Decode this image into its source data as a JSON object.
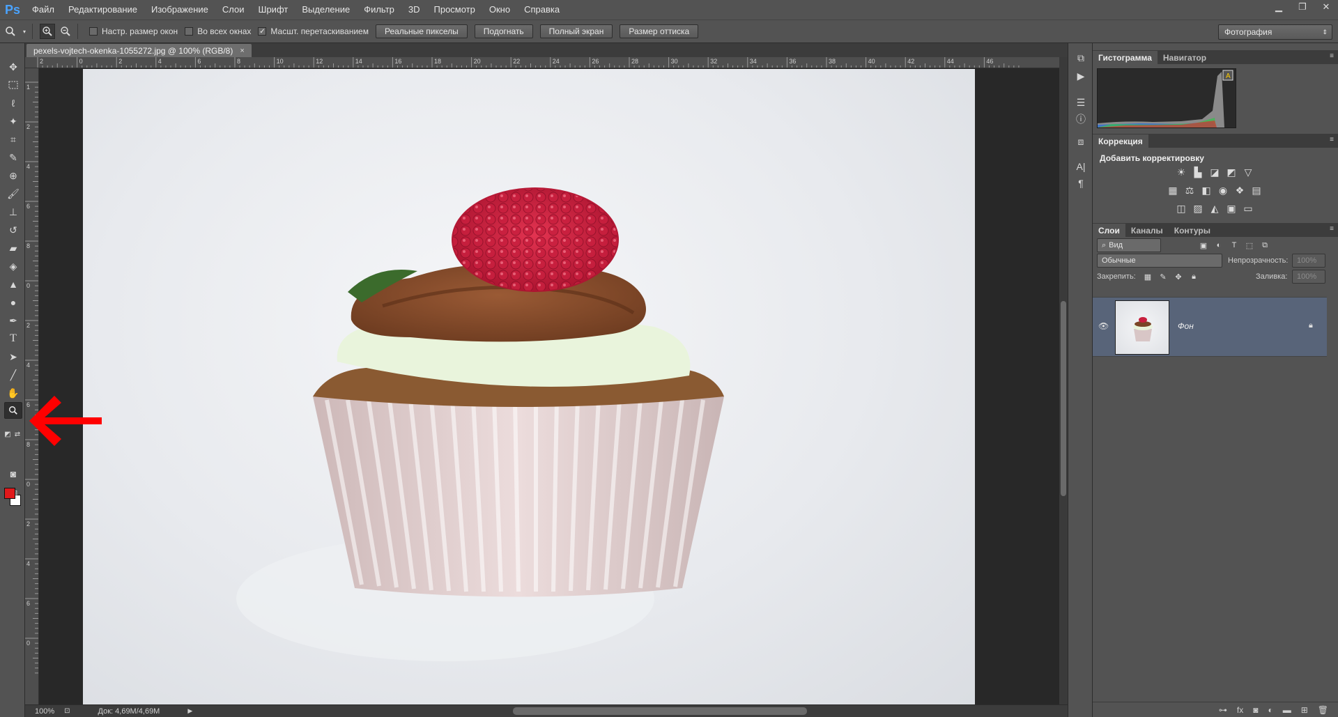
{
  "app": {
    "logo": "Ps"
  },
  "menu": [
    "Файл",
    "Редактирование",
    "Изображение",
    "Слои",
    "Шрифт",
    "Выделение",
    "Фильтр",
    "3D",
    "Просмотр",
    "Окно",
    "Справка"
  ],
  "window_controls": {
    "minimize": "▁",
    "restore": "❐",
    "close": "✕"
  },
  "options": {
    "resize_windows": "Настр. размер окон",
    "all_windows": "Во всех окнах",
    "scrubby_zoom": "Масшт. перетаскиванием",
    "actual_pixels": "Реальные пикселы",
    "fit_screen": "Подогнать",
    "fill_screen": "Полный экран",
    "print_size": "Размер оттиска",
    "workspace": "Фотография"
  },
  "document": {
    "tab_title": "pexels-vojtech-okenka-1055272.jpg @ 100% (RGB/8)",
    "ruler_top": [
      "2",
      "0",
      "2",
      "4",
      "6",
      "8",
      "10",
      "12",
      "14",
      "16",
      "18",
      "20",
      "22",
      "24",
      "26",
      "28",
      "30",
      "32",
      "34",
      "36",
      "38",
      "40",
      "42",
      "44",
      "46"
    ],
    "ruler_left": [
      "1",
      "2",
      "4",
      "6",
      "8",
      "0",
      "2",
      "4",
      "6",
      "8",
      "0",
      "2",
      "4",
      "6",
      "0"
    ]
  },
  "status": {
    "zoom": "100%",
    "doc_size": "Док: 4,69M/4,69M"
  },
  "panels": {
    "histogram_tab": "Гистограмма",
    "navigator_tab": "Навигатор",
    "correction_tab": "Коррекция",
    "add_adjustment": "Добавить корректировку",
    "layers_tab": "Слои",
    "channels_tab": "Каналы",
    "paths_tab": "Контуры",
    "kind_filter": "Вид",
    "blend_mode": "Обычные",
    "opacity_label": "Непрозрачность:",
    "opacity_value": "100%",
    "lock_label": "Закрепить:",
    "fill_label": "Заливка:",
    "fill_value": "100%",
    "layer_name": "Фон"
  },
  "colors": {
    "foreground": "#e0191b",
    "background": "#ffffff",
    "accent": "#4aa3ff",
    "selected_layer": "#586479",
    "arrow": "#ff0000"
  },
  "icons": [
    "zoom-icon",
    "hand-icon",
    "move-icon",
    "marquee-icon",
    "lasso-icon",
    "magic-wand-icon",
    "crop-icon",
    "eyedropper-icon",
    "brush-icon",
    "eye-icon",
    "lock-icon"
  ]
}
